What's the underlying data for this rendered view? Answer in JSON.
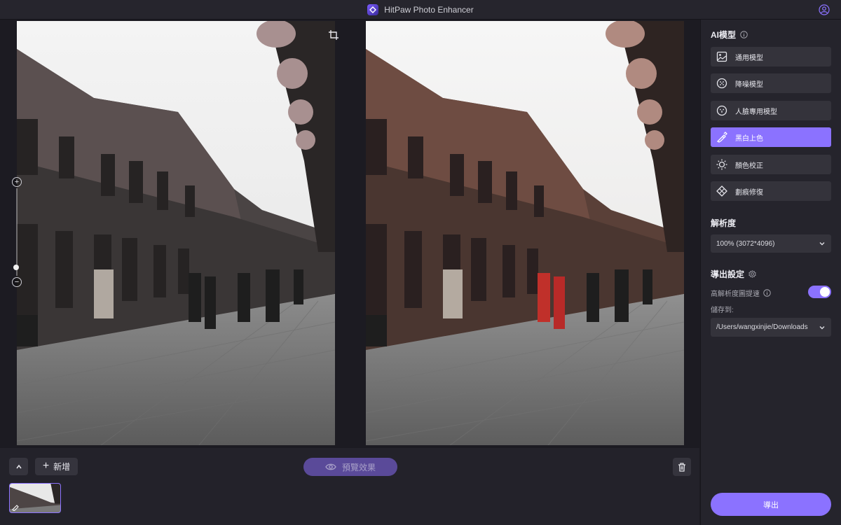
{
  "app": {
    "title": "HitPaw Photo Enhancer"
  },
  "panel": {
    "ai_model_title": "AI模型",
    "models": [
      {
        "label": "通用模型",
        "icon": "image-icon",
        "active": false
      },
      {
        "label": "降噪模型",
        "icon": "denoise-icon",
        "active": false
      },
      {
        "label": "人臉專用模型",
        "icon": "face-icon",
        "active": false
      },
      {
        "label": "黑白上色",
        "icon": "colorize-icon",
        "active": true
      },
      {
        "label": "顏色校正",
        "icon": "color-correct-icon",
        "active": false
      },
      {
        "label": "劃痕修復",
        "icon": "scratch-repair-icon",
        "active": false
      }
    ],
    "resolution_title": "解析度",
    "resolution_value": "100% (3072*4096)",
    "export_settings_title": "導出設定",
    "hires_accel_label": "高解析度圖提速",
    "hires_accel_on": true,
    "save_to_label": "儲存到:",
    "save_path": "/Users/wangxinjie/Downloads",
    "export_button": "導出"
  },
  "bottom": {
    "add_label": "新增",
    "preview_label": "預覽效果"
  },
  "colors": {
    "accent": "#8b72ff",
    "panel_bg": "#25242c",
    "button_bg": "#34333b"
  }
}
